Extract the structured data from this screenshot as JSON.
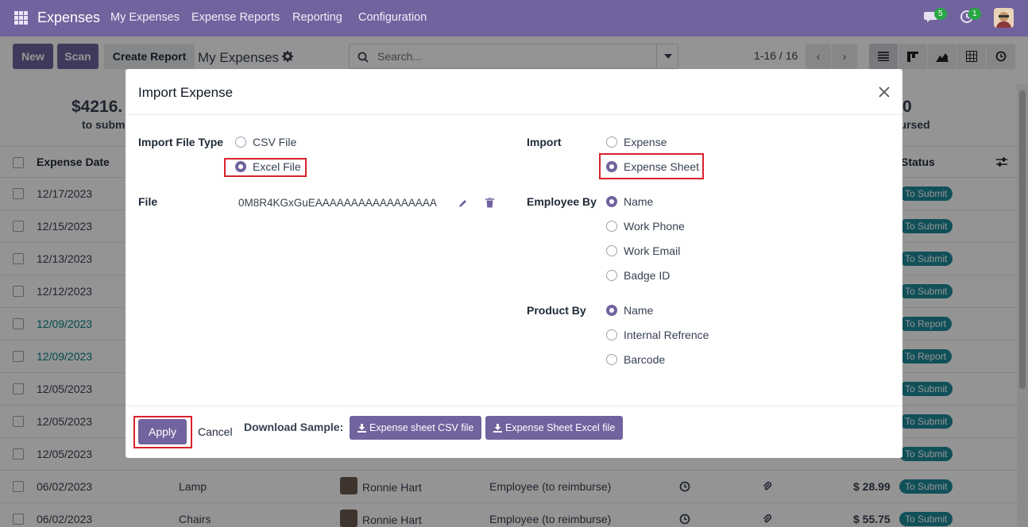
{
  "app": {
    "title": "Expenses",
    "menu": [
      "My Expenses",
      "Expense Reports",
      "Reporting",
      "Configuration"
    ],
    "chat_count": "5",
    "activity_count": "1"
  },
  "controls": {
    "new_label": "New",
    "scan_label": "Scan",
    "create_report_label": "Create Report",
    "breadcrumb": "My Expenses",
    "search_placeholder": "Search...",
    "pager": "1-16 / 16"
  },
  "summary": {
    "left_amount": "$4216.",
    "left_label": "to subm",
    "right_amount": "0",
    "right_label": "bursed"
  },
  "list": {
    "header_date": "Expense Date",
    "header_status": "Status",
    "rows": [
      {
        "date": "12/17/2023",
        "status": "To Submit",
        "link": false
      },
      {
        "date": "12/15/2023",
        "status": "To Submit",
        "link": false
      },
      {
        "date": "12/13/2023",
        "status": "To Submit",
        "link": false
      },
      {
        "date": "12/12/2023",
        "status": "To Submit",
        "link": false
      },
      {
        "date": "12/09/2023",
        "status": "To Report",
        "link": true
      },
      {
        "date": "12/09/2023",
        "status": "To Report",
        "link": true
      },
      {
        "date": "12/05/2023",
        "status": "To Submit",
        "link": false
      },
      {
        "date": "12/05/2023",
        "status": "To Submit",
        "link": false
      },
      {
        "date": "12/05/2023",
        "status": "To Submit",
        "link": false
      },
      {
        "date": "06/02/2023",
        "status": "To Submit",
        "link": false,
        "desc": "Lamp",
        "employee": "Ronnie Hart",
        "paid_by": "Employee (to reimburse)",
        "total": "$ 28.99"
      },
      {
        "date": "06/02/2023",
        "status": "To Submit",
        "link": false,
        "desc": "Chairs",
        "employee": "Ronnie Hart",
        "paid_by": "Employee (to reimburse)",
        "total": "$ 55.75"
      }
    ]
  },
  "modal": {
    "title": "Import Expense",
    "import_file_type_label": "Import File Type",
    "file_type_options": [
      "CSV File",
      "Excel File"
    ],
    "file_type_selected": "Excel File",
    "file_label": "File",
    "file_value": "0M8R4KGxGuEAAAAAAAAAAAAAAAAA",
    "import_label": "Import",
    "import_options": [
      "Expense",
      "Expense Sheet"
    ],
    "import_selected": "Expense Sheet",
    "employee_by_label": "Employee By",
    "employee_by_options": [
      "Name",
      "Work Phone",
      "Work Email",
      "Badge ID"
    ],
    "employee_by_selected": "Name",
    "product_by_label": "Product By",
    "product_by_options": [
      "Name",
      "Internal Refrence",
      "Barcode"
    ],
    "product_by_selected": "Name",
    "apply_label": "Apply",
    "cancel_label": "Cancel",
    "download_sample_label": "Download Sample:",
    "csv_sample_label": "Expense sheet CSV file",
    "excel_sample_label": "Expense Sheet Excel file"
  },
  "colors": {
    "brand": "#71639e",
    "status_badge": "#1d8a9a",
    "highlight": "#d9212c"
  }
}
